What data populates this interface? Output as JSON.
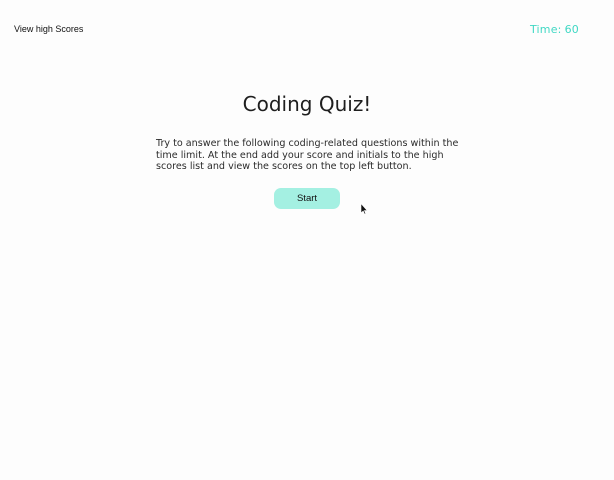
{
  "header": {
    "high_scores_label": "View high Scores",
    "timer_label": "Time:",
    "timer_value": "60"
  },
  "main": {
    "title": "Coding Quiz!",
    "intro": "Try to answer the following coding-related questions within the time limit. At the end add your score and initials to the high scores list and view the scores on the top left button.",
    "start_label": "Start"
  },
  "colors": {
    "accent": "#40d8c4",
    "button_bg": "#a4f0e2",
    "background": "#fdfdfd"
  },
  "icons": {
    "pointer": "mouse-pointer-icon"
  }
}
